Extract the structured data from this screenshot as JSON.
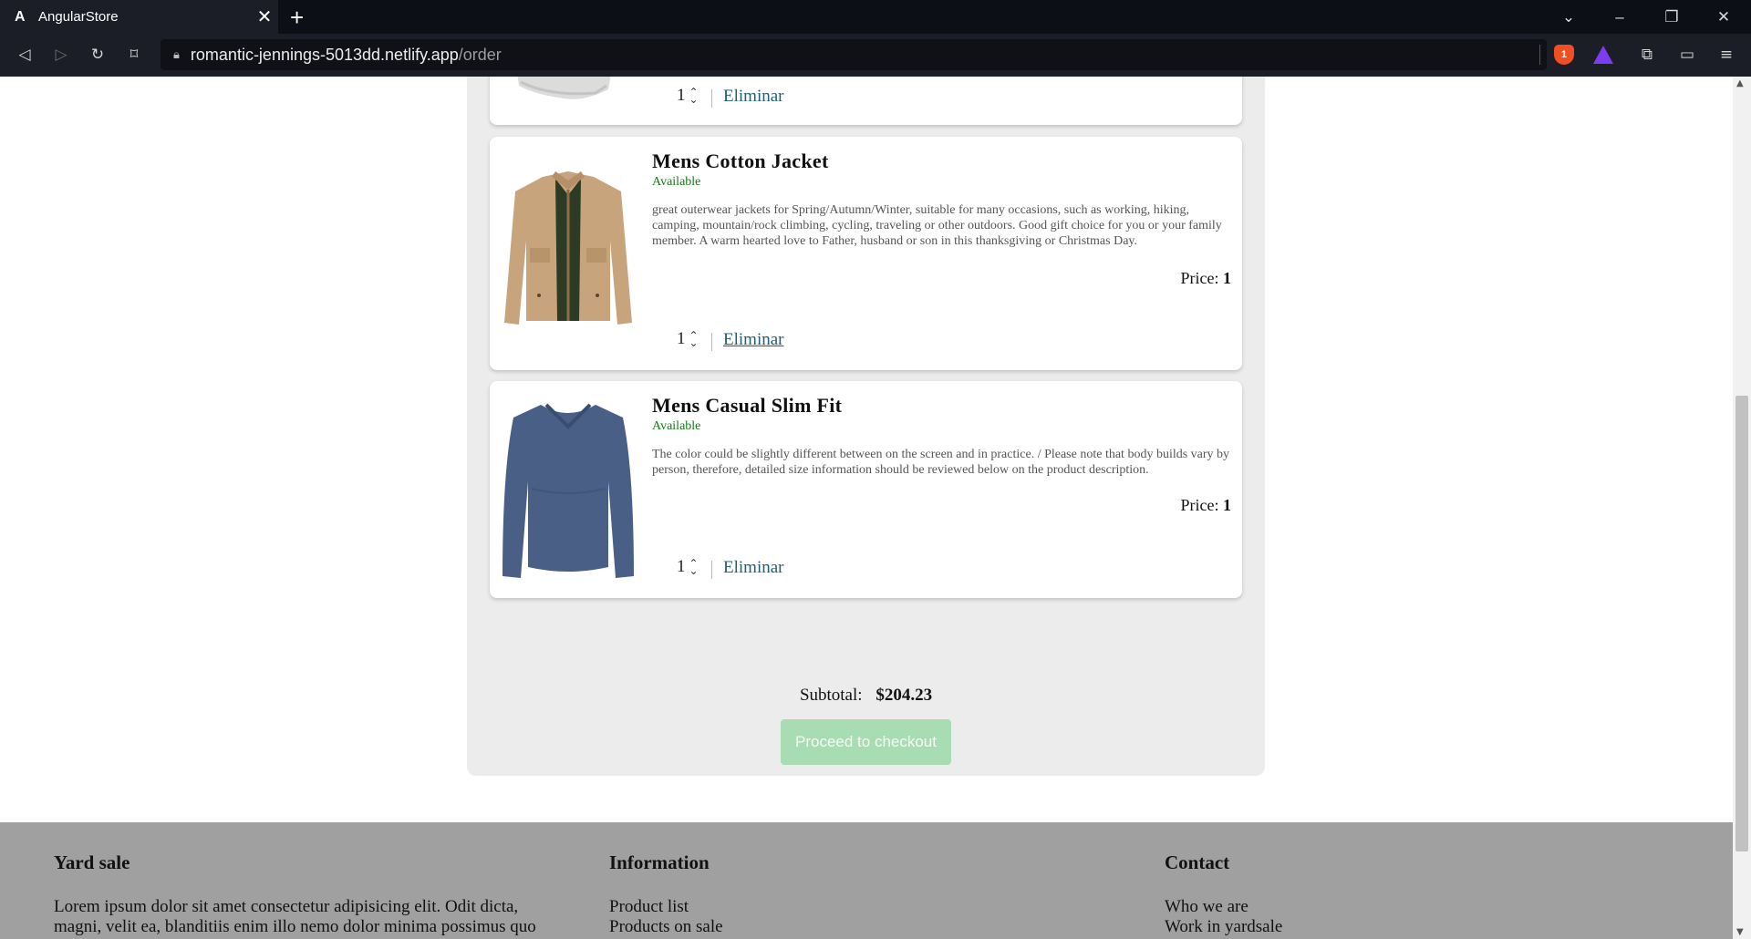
{
  "browser": {
    "tab_title": "AngularStore",
    "url_host": "romantic-jennings-5013dd.netlify.app",
    "url_path": "/order",
    "brave_badge": "1"
  },
  "cart": {
    "first_item": {
      "quantity": "1",
      "remove_label": "Eliminar"
    },
    "items": [
      {
        "title": "Mens Cotton Jacket",
        "status": "Available",
        "description": "great outerwear jackets for Spring/Autumn/Winter, suitable for many occasions, such as working, hiking, camping, mountain/rock climbing, cycling, traveling or other outdoors. Good gift choice for you or your family member. A warm hearted love to Father, husband or son in this thanksgiving or Christmas Day.",
        "price_label": "Price:",
        "price_value": "1",
        "quantity": "1",
        "remove_label": "Eliminar"
      },
      {
        "title": "Mens Casual Slim Fit",
        "status": "Available",
        "description": "The color could be slightly different between on the screen and in practice. / Please note that body builds vary by person, therefore, detailed size information should be reviewed below on the product description.",
        "price_label": "Price:",
        "price_value": "1",
        "quantity": "1",
        "remove_label": "Eliminar"
      }
    ]
  },
  "summary": {
    "subtotal_label": "Subtotal:",
    "subtotal_value": "$204.23",
    "checkout_label": "Proceed to checkout"
  },
  "footer": {
    "col1": {
      "title": "Yard sale",
      "text": "Lorem ipsum dolor sit amet consectetur adipisicing elit. Odit dicta, magni, velit ea, blanditiis enim illo nemo dolor minima possimus quo"
    },
    "col2": {
      "title": "Information",
      "links": [
        "Product list",
        "Products on sale"
      ]
    },
    "col3": {
      "title": "Contact",
      "links": [
        "Who we are",
        "Work in yardsale"
      ]
    }
  }
}
